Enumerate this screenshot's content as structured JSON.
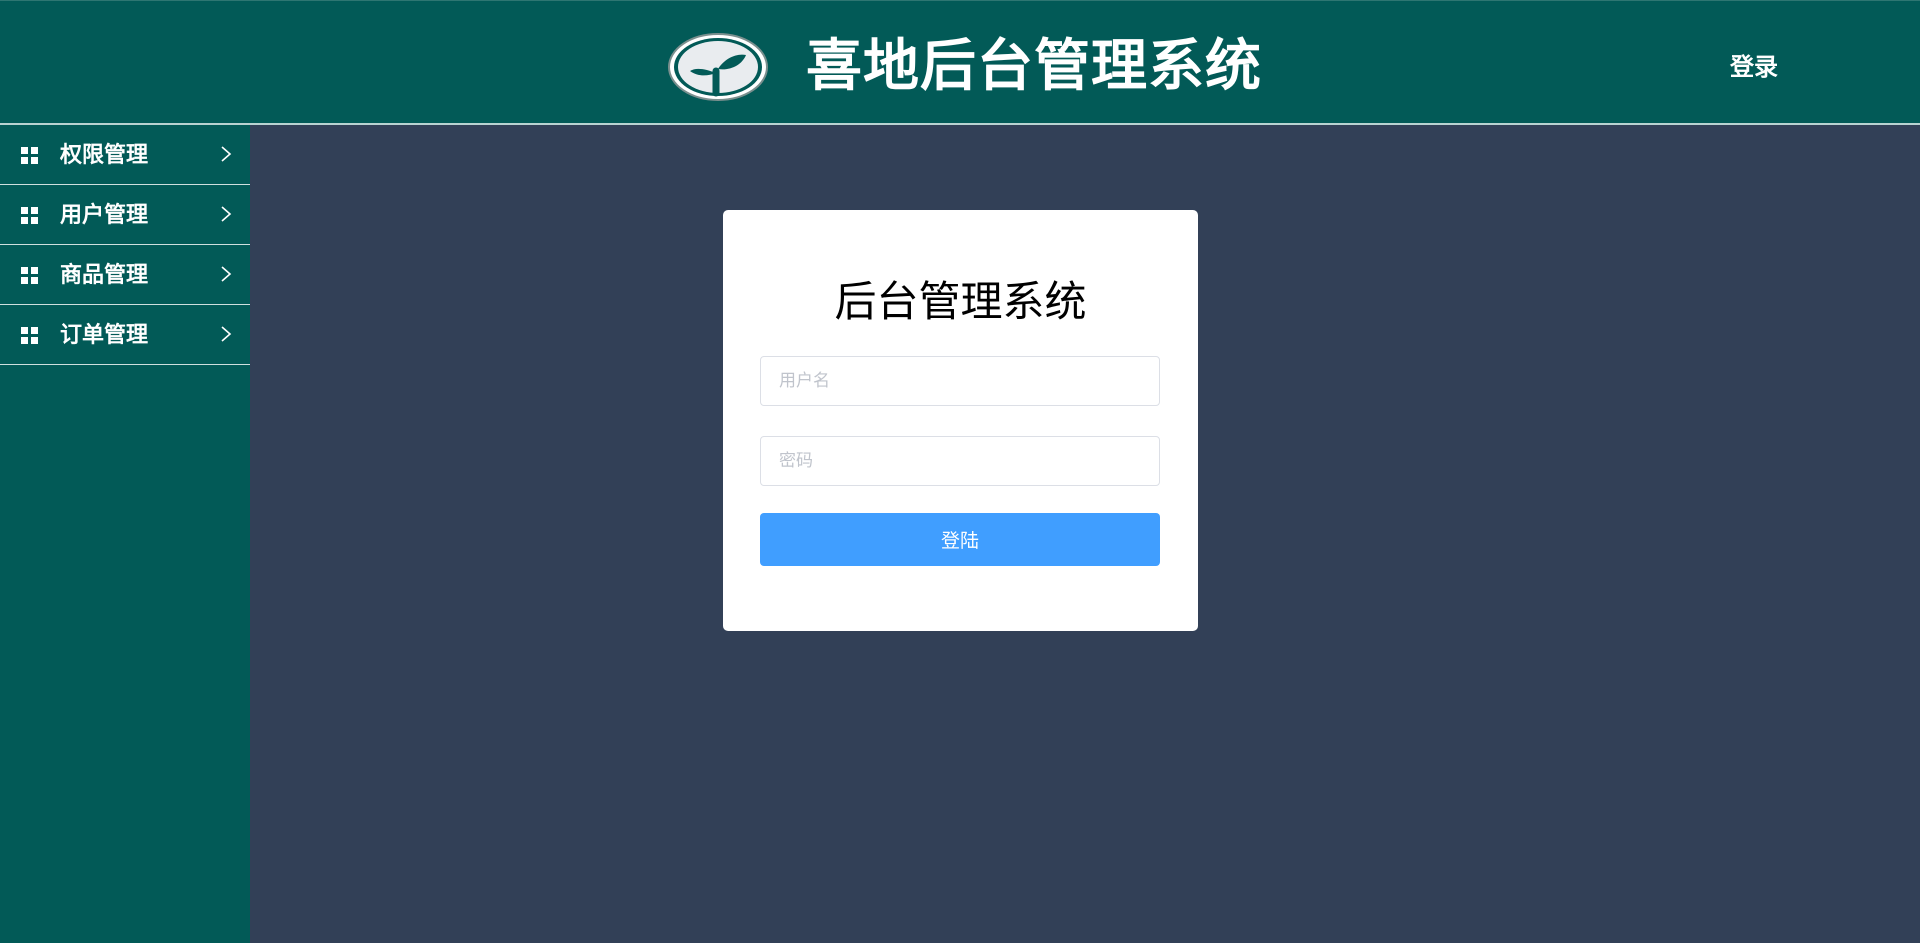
{
  "header": {
    "title": "喜地后台管理系统",
    "login_link": "登录",
    "logo_icon": "sprout-logo-icon"
  },
  "sidebar": {
    "items": [
      {
        "label": "权限管理",
        "icon": "grid-icon"
      },
      {
        "label": "用户管理",
        "icon": "grid-icon"
      },
      {
        "label": "商品管理",
        "icon": "grid-icon"
      },
      {
        "label": "订单管理",
        "icon": "grid-icon"
      }
    ]
  },
  "login": {
    "title": "后台管理系统",
    "username_placeholder": "用户名",
    "password_placeholder": "密码",
    "submit_label": "登陆"
  },
  "colors": {
    "header_bg": "#025a57",
    "content_bg": "#324057",
    "primary": "#409eff"
  }
}
